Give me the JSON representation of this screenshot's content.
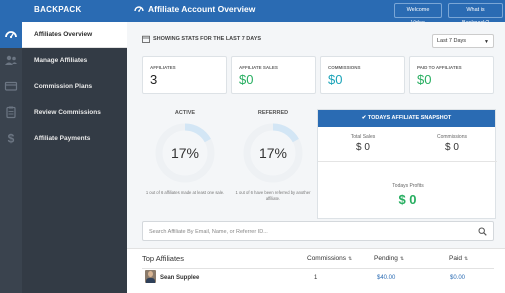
{
  "topbar": {
    "brand": "BACKPACK",
    "title": "Affiliate Account Overview",
    "title_icon": "dashboard-gauge-icon",
    "welcome_button": "Welcome Video",
    "what_button": "What is Backpack?"
  },
  "sidebar": {
    "items": [
      {
        "label": "Affiliates Overview",
        "icon": "gauge-icon",
        "active": true
      },
      {
        "label": "Manage Affiliates",
        "icon": "users-icon",
        "active": false
      },
      {
        "label": "Commission Plans",
        "icon": "card-icon",
        "active": false
      },
      {
        "label": "Review Commissions",
        "icon": "clipboard-icon",
        "active": false
      },
      {
        "label": "Affiliate Payments",
        "icon": "dollar-icon",
        "active": false
      }
    ]
  },
  "stats": {
    "heading": "SHOWING STATS FOR THE LAST 7 DAYS",
    "range": "Last 7 Days",
    "cards": [
      {
        "label": "AFFILIATES",
        "value": "3"
      },
      {
        "label": "AFFILIATE SALES",
        "value": "$0"
      },
      {
        "label": "COMMISSIONS",
        "value": "$0"
      },
      {
        "label": "PAID TO AFFILIATES",
        "value": "$0"
      }
    ]
  },
  "rings": {
    "active": {
      "title": "ACTIVE",
      "percent": "17%",
      "fraction": 0.17,
      "note": "1 out of 6 affiliates made at least one sale."
    },
    "referred": {
      "title": "REFERRED",
      "percent": "17%",
      "fraction": 0.17,
      "note": "1 out of 6 have been referred by another affiliate."
    }
  },
  "snapshot": {
    "title": "TODAYS AFFILIATE SNAPSHOT",
    "total_sales_label": "Total Sales",
    "total_sales_value": "$ 0",
    "commissions_label": "Commissions",
    "commissions_value": "$ 0",
    "profits_label": "Todays Profits",
    "profits_value": "$ 0"
  },
  "search": {
    "placeholder": "Search Affiliate By Email, Name, or Referrer ID..."
  },
  "table": {
    "title": "Top Affiliates",
    "columns": [
      "Commissions",
      "Pending",
      "Paid"
    ],
    "rows": [
      {
        "name": "Sean Supplee",
        "commissions": "1",
        "pending": "$40.00",
        "paid": "$0.00"
      }
    ]
  },
  "colors": {
    "brand_blue": "#2a6bb3",
    "sidebar": "#333b45",
    "green": "#27ae60",
    "teal": "#1aa3b8"
  }
}
